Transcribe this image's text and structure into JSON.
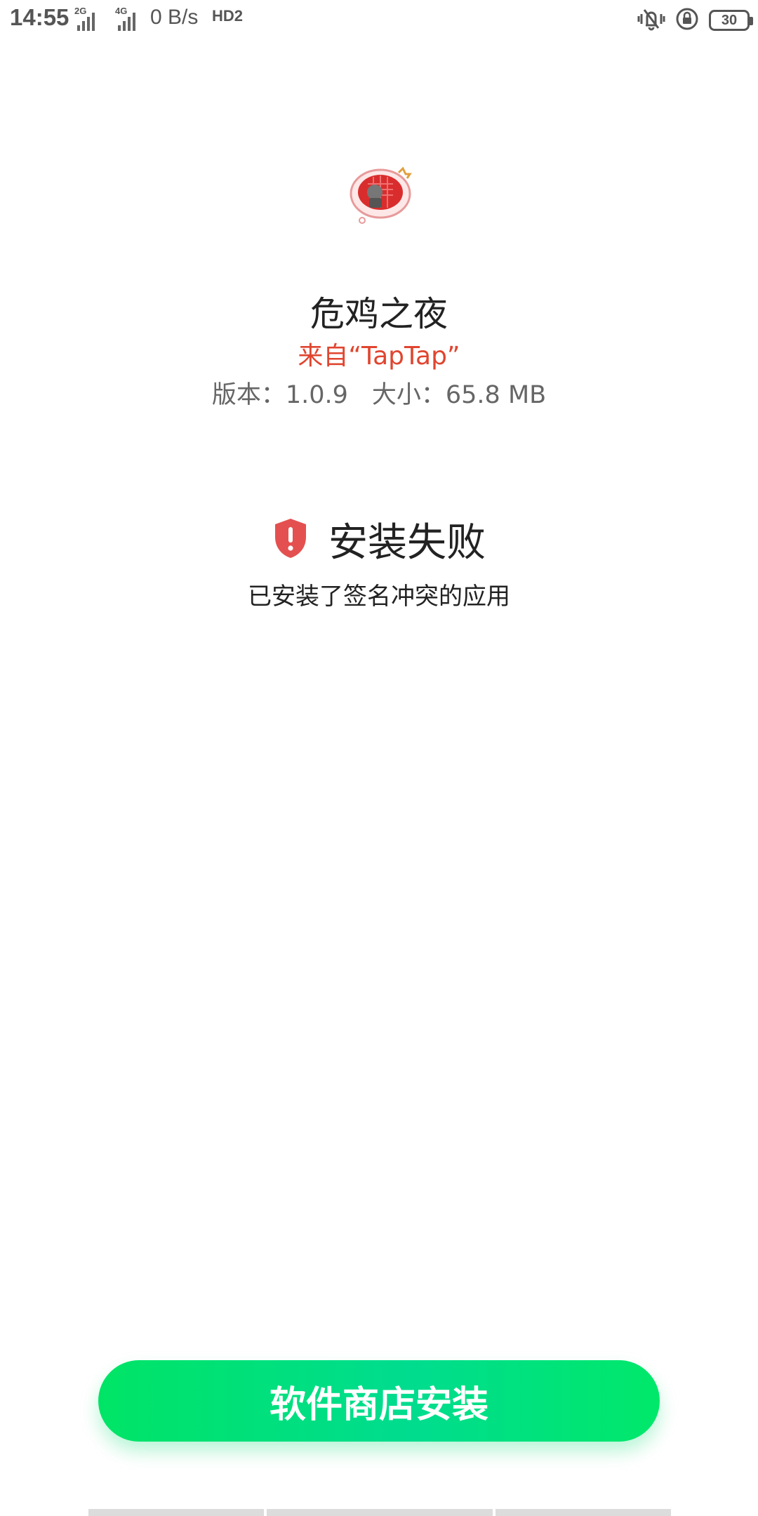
{
  "status_bar": {
    "time": "14:55",
    "signal_1_label": "2G",
    "signal_2_label": "4G",
    "net_speed": "0 B/s",
    "hd_badge": "HD2",
    "battery": "30",
    "icons": [
      "vibrate-icon",
      "rotation-lock-icon",
      "battery-icon"
    ]
  },
  "app": {
    "icon": "game-app-icon",
    "name": "危鸡之夜",
    "source": "来自“TapTap”",
    "version": "版本：1.0.9",
    "size": "大小：65.8 MB"
  },
  "install_result": {
    "icon": "shield-warning-icon",
    "title": "安装失败",
    "reason": "已安装了签名冲突的应用"
  },
  "actions": {
    "store_install_label": "软件商店安装"
  },
  "colors": {
    "source_text": "#e0452f",
    "shield": "#e45050",
    "button_green": "#00e07a"
  }
}
